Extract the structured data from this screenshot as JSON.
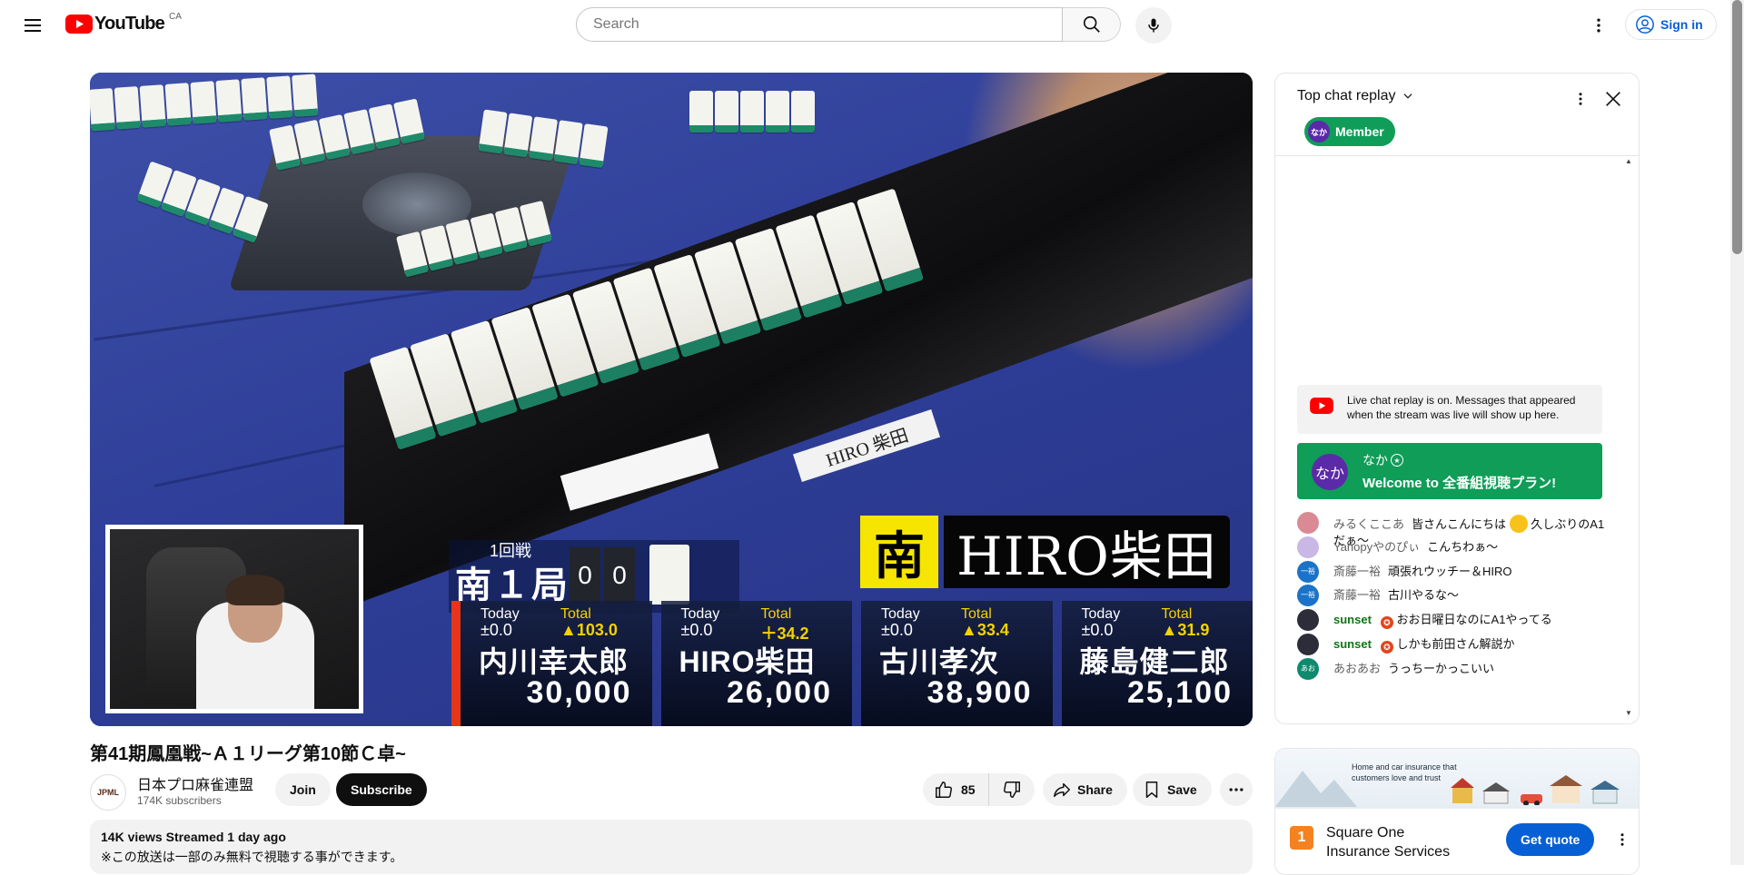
{
  "masthead": {
    "logo_text": "YouTube",
    "country_code": "CA",
    "search_placeholder": "Search",
    "signin_label": "Sign in",
    "icons": [
      "menu-icon",
      "search-icon",
      "mic-icon",
      "more-vert-icon",
      "account-circle-icon"
    ]
  },
  "player": {
    "overlay": {
      "round_label": "1回戦",
      "round_name": "南１局",
      "counter_left": "0",
      "counter_right": "0",
      "seat_wind": "南",
      "current_player": "HIRO柴田",
      "nameplate": "HIRO 柴田",
      "scores": [
        {
          "today_label": "Today",
          "today_value": "±0.0",
          "total_label": "Total",
          "total_value": "▲103.0",
          "name": "内川幸太郎",
          "points": "30,000",
          "active": true
        },
        {
          "today_label": "Today",
          "today_value": "±0.0",
          "total_label": "Total",
          "total_value": "＋34.2",
          "name": "HIRO柴田",
          "points": "26,000",
          "active": false
        },
        {
          "today_label": "Today",
          "today_value": "±0.0",
          "total_label": "Total",
          "total_value": "▲33.4",
          "name": "古川孝次",
          "points": "38,900",
          "active": false
        },
        {
          "today_label": "Today",
          "today_value": "±0.0",
          "total_label": "Total",
          "total_value": "▲31.9",
          "name": "藤島健二郎",
          "points": "25,100",
          "active": false
        }
      ]
    }
  },
  "video": {
    "title": "第41期鳳凰戦~Ａ１リーグ第10節Ｃ卓~",
    "channel_name": "日本プロ麻雀連盟",
    "subscribers": "174K subscribers",
    "join_label": "Join",
    "subscribe_label": "Subscribe",
    "like_count": "85",
    "share_label": "Share",
    "save_label": "Save",
    "views_meta": "14K views  Streamed 1 day ago",
    "description_line": "※この放送は一部のみ無料で視聴する事ができます。"
  },
  "chat": {
    "mode_label": "Top chat replay",
    "member_chip_label": "Member",
    "member_chip_avatar": "なか",
    "replay_note": "Live chat replay is on. Messages that appeared when the stream was live will show up here.",
    "welcome": {
      "avatar_text": "なか",
      "author": "なか",
      "message": "Welcome to 全番組視聴プラン!"
    },
    "messages": [
      {
        "author": "みるくここあ",
        "text": "皆さんこんにちは",
        "after_emoji": "久しぶりのA1だぁ～",
        "avatar_color": "#d98a94",
        "avatar_text": ""
      },
      {
        "author": "Yanopyやのぴぃ",
        "text": "こんちわぁ～",
        "avatar_color": "#c9b8e6",
        "avatar_text": ""
      },
      {
        "author": "斎藤一裕",
        "text": "頑張れウッチー＆HIRO",
        "avatar_color": "#1a73c9",
        "avatar_text": "一裕"
      },
      {
        "author": "斎藤一裕",
        "text": "古川やるな～",
        "avatar_color": "#1a73c9",
        "avatar_text": "一裕"
      },
      {
        "author": "sunset",
        "text": "おお日曜日なのにA1やってる",
        "avatar_color": "#2d2d3a",
        "avatar_text": "",
        "member": true
      },
      {
        "author": "sunset",
        "text": "しかも前田さん解説か",
        "avatar_color": "#2d2d3a",
        "avatar_text": "",
        "member": true
      },
      {
        "author": "あおあお",
        "text": "うっちーかっこいい",
        "avatar_color": "#0f8a6e",
        "avatar_text": "あお"
      }
    ]
  },
  "ad": {
    "banner_text": "Home and car insurance that customers love and trust",
    "logo_text": "1",
    "advertiser": "Square One Insurance Services",
    "cta_label": "Get quote"
  },
  "colors": {
    "brand_red": "#ff0000",
    "subscribe_bg": "#0f0f0f",
    "member_green": "#0f9d58",
    "link_blue": "#065fd4"
  }
}
